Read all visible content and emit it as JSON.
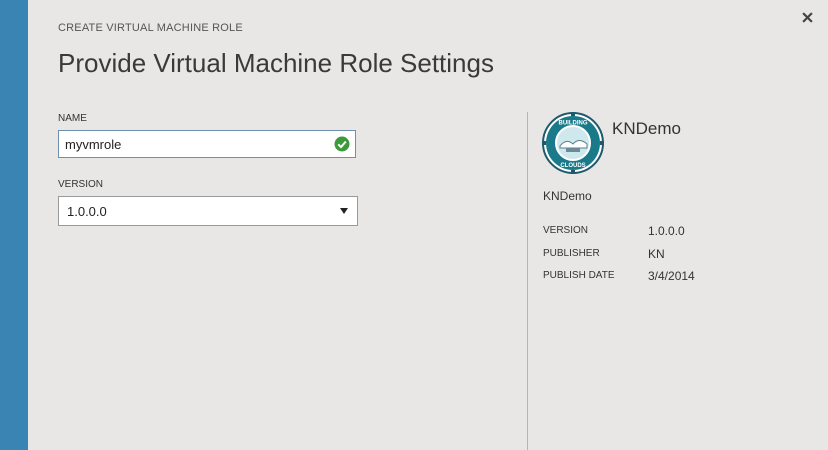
{
  "header": {
    "subtitle": "CREATE VIRTUAL MACHINE ROLE",
    "title": "Provide Virtual Machine Role Settings"
  },
  "form": {
    "name_label": "NAME",
    "name_value": "myvmrole",
    "version_label": "VERSION",
    "version_selected": "1.0.0.0"
  },
  "details": {
    "logo_text_top": "BUILDING",
    "logo_text_bottom": "CLOUDS",
    "role_name": "KNDemo",
    "description": "KNDemo",
    "version_label": "VERSION",
    "version_value": "1.0.0.0",
    "publisher_label": "PUBLISHER",
    "publisher_value": "KN",
    "publish_date_label": "PUBLISH DATE",
    "publish_date_value": "3/4/2014"
  },
  "colors": {
    "accent_stripe": "#3a84b4",
    "valid_check": "#3c9a3a",
    "input_border": "#6d8fb0"
  },
  "icons": {
    "close": "close-icon",
    "valid": "checkmark-icon",
    "dropdown": "chevron-down-icon"
  }
}
